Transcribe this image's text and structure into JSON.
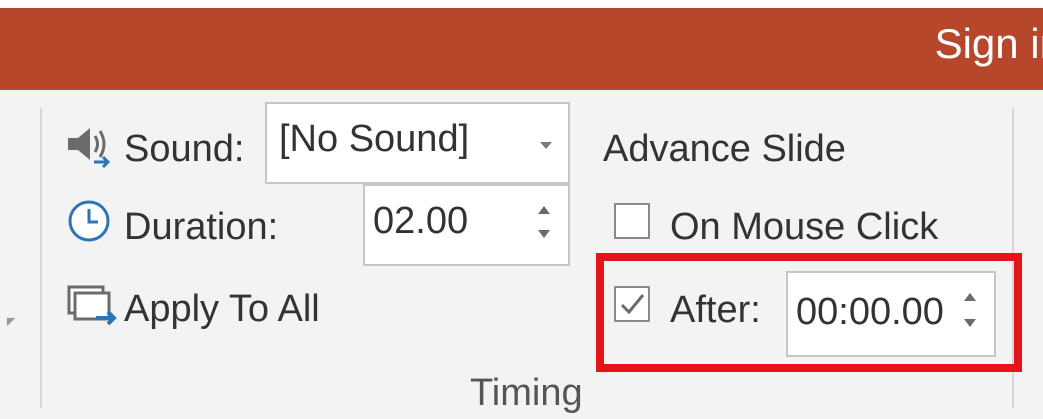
{
  "window": {
    "signin_label": "Sign in"
  },
  "transition": {
    "sound_label": "Sound:",
    "sound_value": "[No Sound]",
    "duration_label": "Duration:",
    "duration_value": "02.00",
    "apply_to_all_label": "Apply To All"
  },
  "advance": {
    "title": "Advance Slide",
    "on_mouse_click_label": "On Mouse Click",
    "on_mouse_click_checked": false,
    "after_label": "After:",
    "after_checked": true,
    "after_value": "00:00.00"
  },
  "group": {
    "label": "Timing"
  },
  "icons": {
    "sound": "speaker-icon",
    "duration": "clock-icon",
    "apply": "apply-to-all-icon",
    "checkmark": "checkmark-icon"
  },
  "colors": {
    "titlebar": "#b7472a",
    "ribbon": "#f3f3f3",
    "highlight": "#e4141b",
    "icon_blue": "#2e75b6"
  }
}
